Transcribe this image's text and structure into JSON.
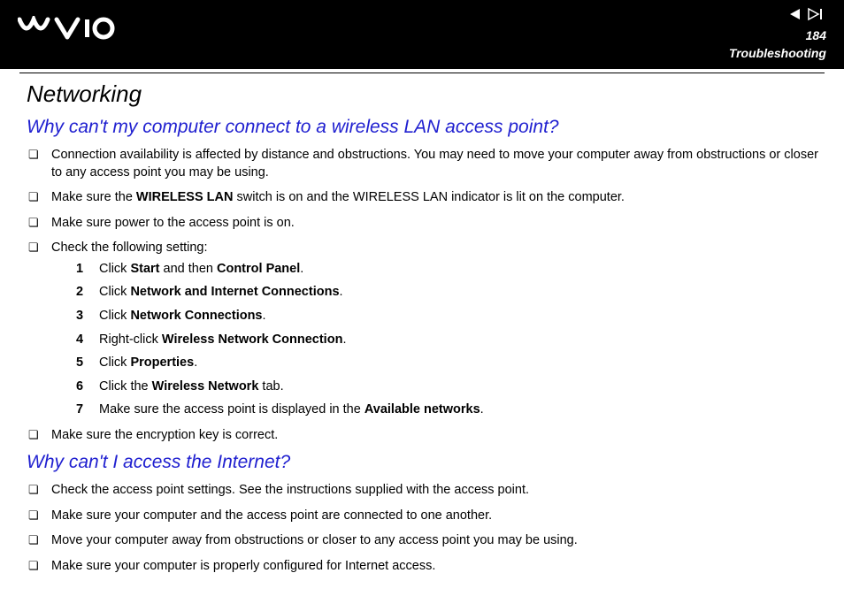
{
  "header": {
    "page_number": "184",
    "section": "Troubleshooting"
  },
  "title": "Networking",
  "q1": {
    "question": "Why can't my computer connect to a wireless LAN access point?",
    "b1": "Connection availability is affected by distance and obstructions. You may need to move your computer away from obstructions or closer to any access point you may be using.",
    "b2_pre": "Make sure the ",
    "b2_bold1": "WIRELESS LAN",
    "b2_post": " switch is on and the WIRELESS LAN indicator is lit on the computer.",
    "b3": "Make sure power to the access point is on.",
    "b4": "Check the following setting:",
    "steps": {
      "s1_pre": "Click ",
      "s1_b1": "Start",
      "s1_mid": " and then ",
      "s1_b2": "Control Panel",
      "s1_post": ".",
      "s2_pre": "Click ",
      "s2_b1": "Network and Internet Connections",
      "s2_post": ".",
      "s3_pre": "Click ",
      "s3_b1": "Network Connections",
      "s3_post": ".",
      "s4_pre": "Right-click ",
      "s4_b1": "Wireless Network Connection",
      "s4_post": ".",
      "s5_pre": "Click ",
      "s5_b1": "Properties",
      "s5_post": ".",
      "s6_pre": "Click the ",
      "s6_b1": "Wireless Network",
      "s6_post": " tab.",
      "s7_pre": "Make sure the access point is displayed in the ",
      "s7_b1": "Available networks",
      "s7_post": "."
    },
    "b5": "Make sure the encryption key is correct."
  },
  "q2": {
    "question": "Why can't I access the Internet?",
    "b1": "Check the access point settings. See the instructions supplied with the access point.",
    "b2": "Make sure your computer and the access point are connected to one another.",
    "b3": "Move your computer away from obstructions or closer to any access point you may be using.",
    "b4": "Make sure your computer is properly configured for Internet access."
  }
}
